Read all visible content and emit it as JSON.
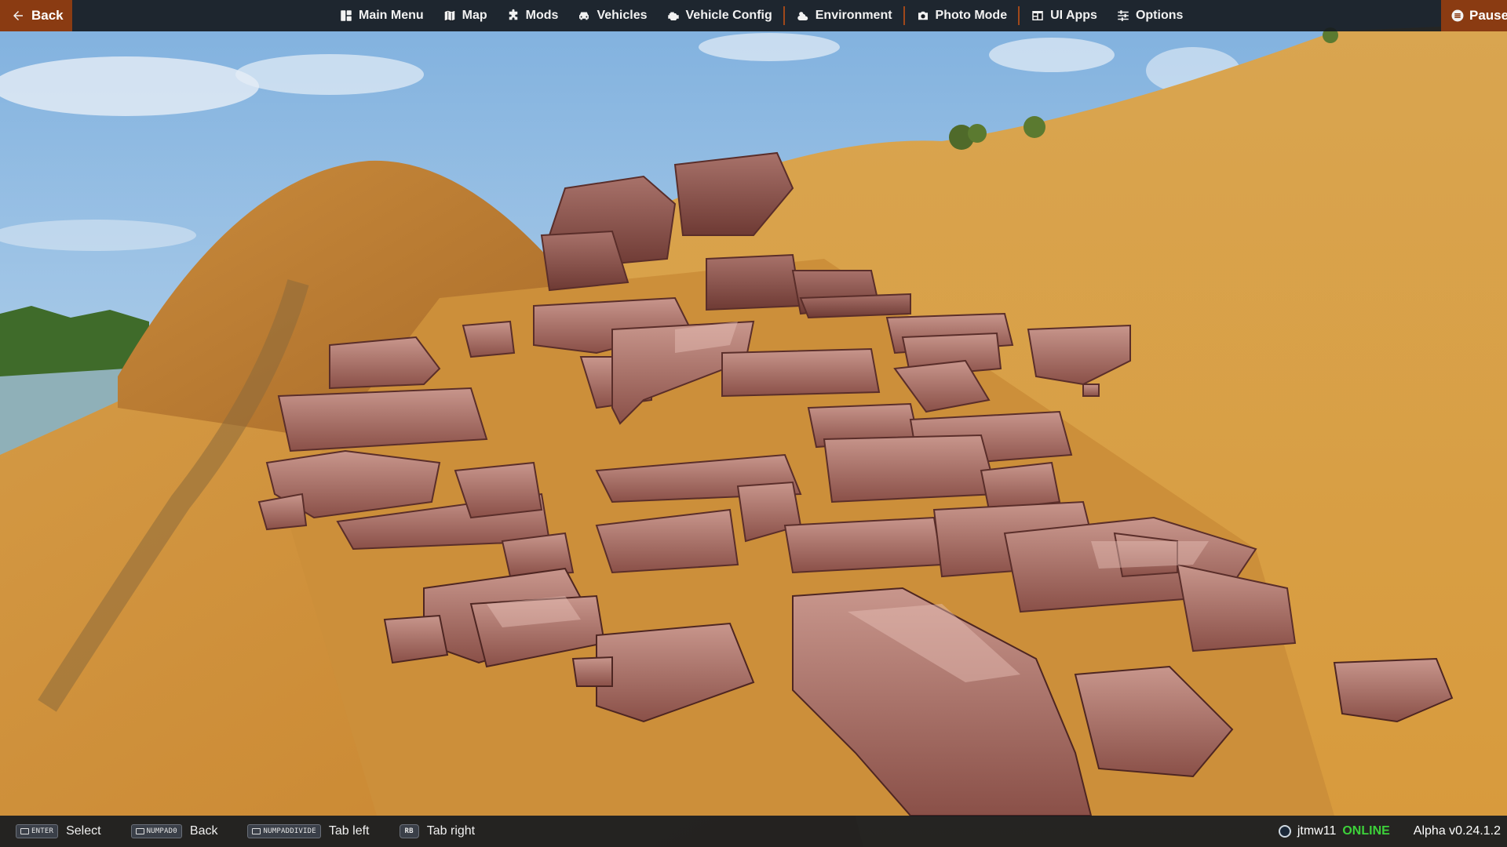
{
  "topbar": {
    "back_label": "Back",
    "pause_label": "Pause",
    "menu": [
      {
        "label": "Main Menu",
        "icon": "main-menu-icon"
      },
      {
        "label": "Map",
        "icon": "map-icon"
      },
      {
        "label": "Mods",
        "icon": "puzzle-icon"
      },
      {
        "label": "Vehicles",
        "icon": "car-icon"
      },
      {
        "label": "Vehicle Config",
        "icon": "engine-icon"
      },
      {
        "label": "Environment",
        "icon": "weather-icon"
      },
      {
        "label": "Photo Mode",
        "icon": "camera-icon"
      },
      {
        "label": "UI Apps",
        "icon": "ui-apps-icon"
      },
      {
        "label": "Options",
        "icon": "sliders-icon"
      }
    ]
  },
  "bottombar": {
    "hints": [
      {
        "key": "ENTER",
        "label": "Select"
      },
      {
        "key": "NUMPAD0",
        "label": "Back"
      },
      {
        "key": "NUMPADDIVIDE",
        "label": "Tab left"
      },
      {
        "key": "RB",
        "label": "Tab right"
      }
    ],
    "username": "jtmw11",
    "status": "ONLINE",
    "version": "Alpha v0.24.1.2"
  },
  "colors": {
    "accent": "#8a3b12",
    "online": "#3dd13a",
    "bar_bg": "#161a20"
  }
}
